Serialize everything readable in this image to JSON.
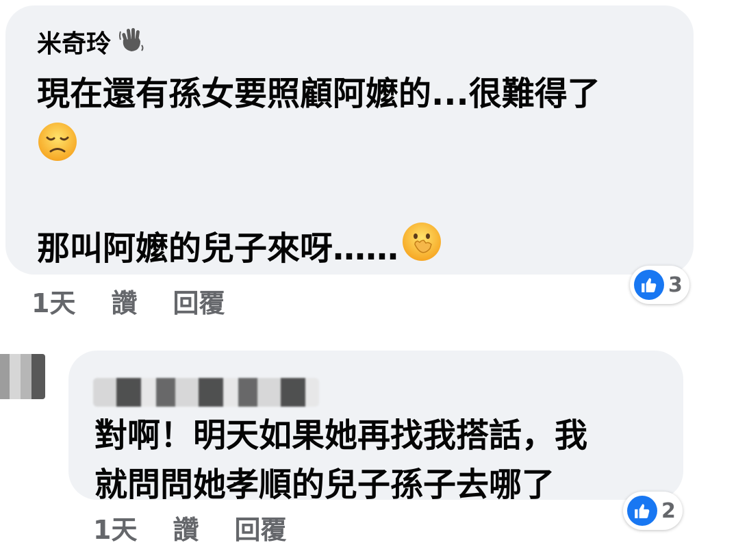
{
  "comments": [
    {
      "author": "米奇玲",
      "author_badge_icon": "waving-hand-icon",
      "lines": [
        "現在還有孫女要照顧阿嬤的...很難得了"
      ],
      "emoji_line_icon": "disappointed-face-emoji",
      "last_line": "那叫阿嬤的兒子來呀……",
      "last_emoji_icon": "face-with-hand-over-mouth-emoji",
      "time": "1天",
      "like_label": "讚",
      "reply_label": "回覆",
      "reaction_count": "3"
    },
    {
      "author": "",
      "lines": [
        "對啊！明天如果她再找我搭話，我",
        "就問問她孝順的兒子孫子去哪了"
      ],
      "time": "1天",
      "like_label": "讚",
      "reply_label": "回覆",
      "reaction_count": "2"
    }
  ],
  "colors": {
    "bubble": "#f0f2f5",
    "meta_text": "#65676b",
    "like_blue": "#1877f2"
  }
}
